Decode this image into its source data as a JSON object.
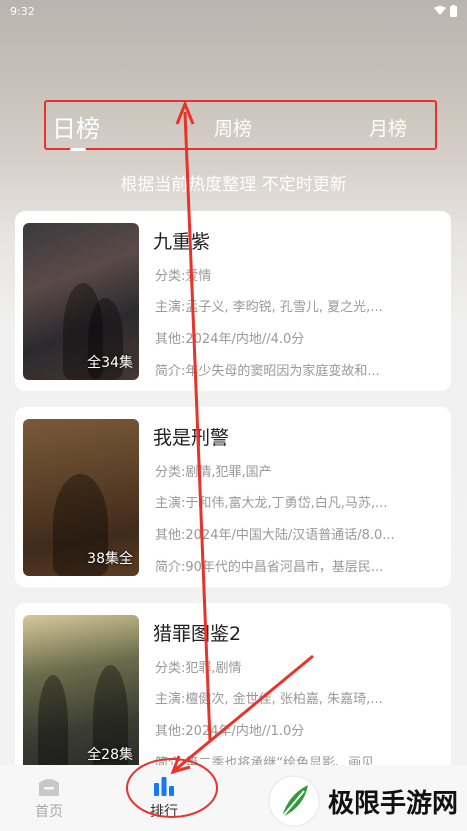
{
  "status_bar": {
    "time": "9:32"
  },
  "tabs": {
    "daily": "日榜",
    "weekly": "周榜",
    "monthly": "月榜"
  },
  "subtitle": "根据当前热度整理 不定时更新",
  "items": [
    {
      "title": "九重紫",
      "episodes": "全34集",
      "genre_label": "分类:",
      "genre": "爱情",
      "cast_label": "主演:",
      "cast": "孟子义, 李昀锐, 孔雪儿, 夏之光,...",
      "other_label": "其他:",
      "other": "2024年/内地//4.0分",
      "intro_label": "简介:",
      "intro": "年少失母的窦昭因为家庭变故和..."
    },
    {
      "title": "我是刑警",
      "episodes": "38集全",
      "genre_label": "分类:",
      "genre": "剧情,犯罪,国产",
      "cast_label": "主演:",
      "cast": "于和伟,富大龙,丁勇岱,白凡,马苏,...",
      "other_label": "其他:",
      "other": "2024年/中国大陆/汉语普通话/8.0...",
      "intro_label": "简介:",
      "intro": "90年代的中昌省河昌市，基层民..."
    },
    {
      "title": "猎罪图鉴2",
      "episodes": "全28集",
      "genre_label": "分类:",
      "genre": "犯罪,剧情",
      "cast_label": "主演:",
      "cast": "檀健次, 金世佳, 张柏嘉, 朱嘉琦,...",
      "other_label": "其他:",
      "other": "2024年/内地//1.0分",
      "intro_label": "简介:",
      "intro": "第二季也将承继“绘色显影、画见..."
    }
  ],
  "bottom_nav": {
    "home": "首页",
    "rank": "排行"
  },
  "watermark": {
    "text": "极限手游网"
  },
  "colors": {
    "annotation": "#e8332b",
    "accent_blue": "#1677ff",
    "watermark_green": "#2e9b3a"
  }
}
